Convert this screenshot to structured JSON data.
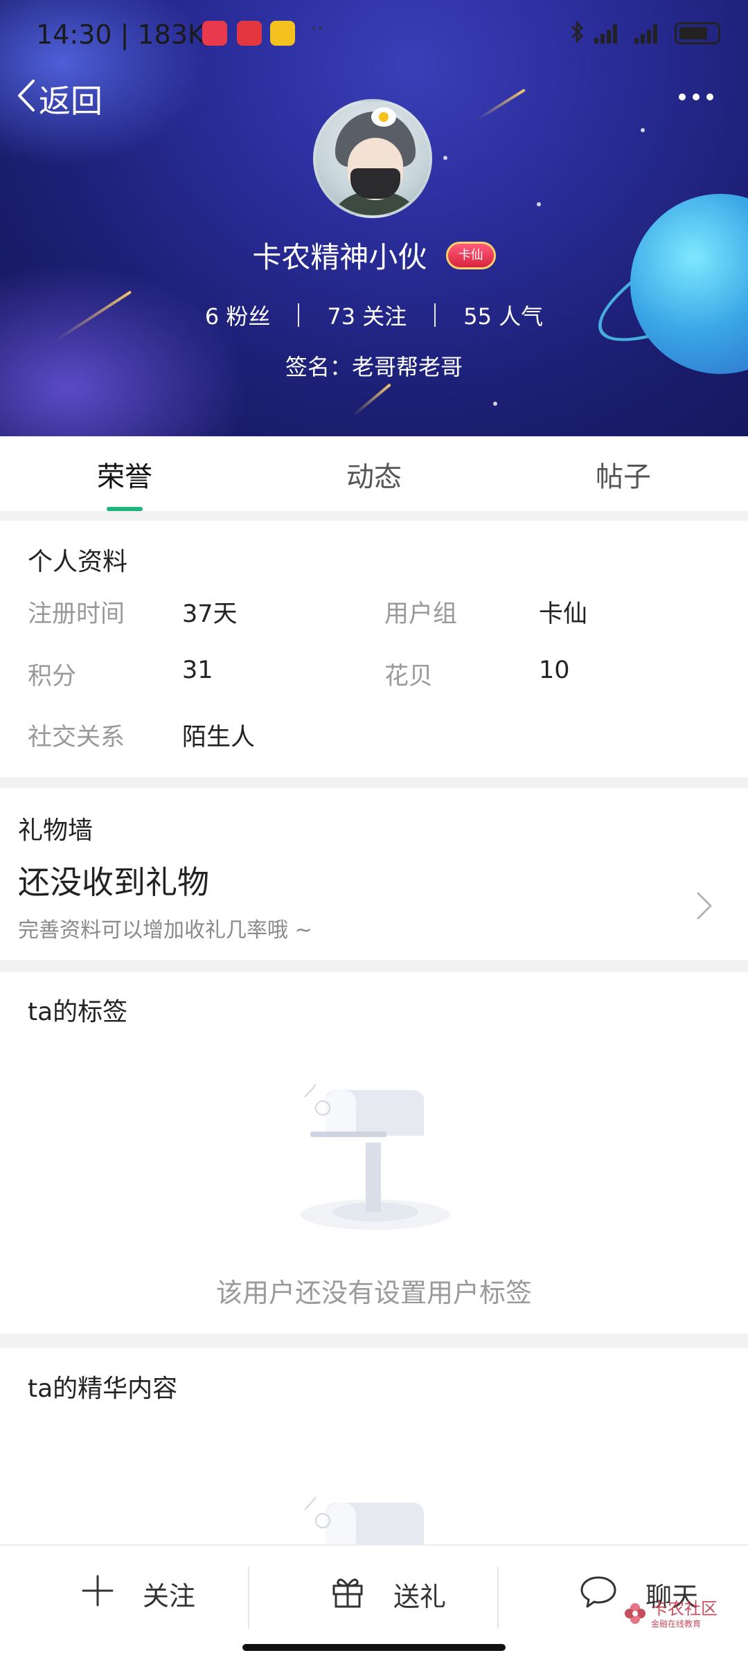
{
  "status_bar": {
    "time": "14:30 | 183K/s",
    "dots": "··"
  },
  "nav": {
    "back_label": "返回"
  },
  "profile": {
    "username": "卡农精神小伙",
    "badge_label": "卡仙",
    "stats": [
      {
        "value": "6",
        "label": "粉丝",
        "text": "6 粉丝"
      },
      {
        "value": "73",
        "label": "关注",
        "text": "73 关注"
      },
      {
        "value": "55",
        "label": "人气",
        "text": "55 人气"
      }
    ],
    "signature": "签名：老哥帮老哥"
  },
  "tabs": [
    {
      "label": "荣誉",
      "active": true
    },
    {
      "label": "动态",
      "active": false
    },
    {
      "label": "帖子",
      "active": false
    }
  ],
  "personal_info": {
    "title": "个人资料",
    "fields": [
      {
        "label": "注册时间",
        "value": "37天"
      },
      {
        "label": "用户组",
        "value": "卡仙"
      },
      {
        "label": "积分",
        "value": "31"
      },
      {
        "label": "花贝",
        "value": "10"
      },
      {
        "label": "社交关系",
        "value": "陌生人"
      }
    ]
  },
  "gift_wall": {
    "title": "礼物墙",
    "empty_title": "还没收到礼物",
    "empty_hint": "完善资料可以增加收礼几率哦 ~"
  },
  "tags": {
    "title": "ta的标签",
    "empty_text": "该用户还没有设置用户标签"
  },
  "featured": {
    "title": "ta的精华内容"
  },
  "bottom_bar": {
    "follow": "关注",
    "gift": "送礼",
    "chat": "聊天"
  },
  "watermark": {
    "text": "卡农社区",
    "sub": "金融在线教育"
  },
  "colors": {
    "accent": "#21b37c",
    "header_bg": "#1f2280"
  },
  "icons": [
    "back-chevron-icon",
    "more-dots-icon",
    "plus-icon",
    "gift-icon",
    "chat-bubble-icon",
    "chevron-right-icon",
    "mailbox-icon"
  ]
}
